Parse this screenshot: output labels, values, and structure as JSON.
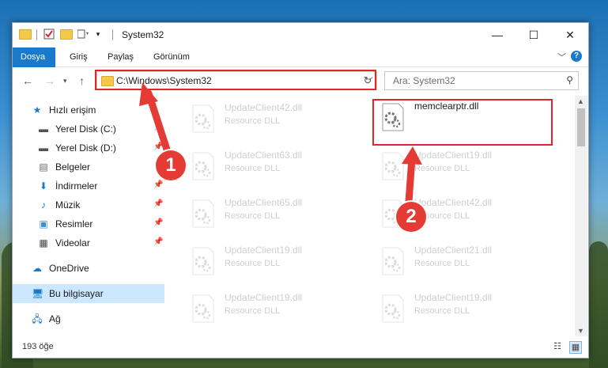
{
  "window": {
    "title": "System32"
  },
  "controls": {
    "minimize": "—",
    "maximize": "☐",
    "close": "✕"
  },
  "ribbon": {
    "tabs": [
      "Dosya",
      "Giriş",
      "Paylaş",
      "Görünüm"
    ],
    "help": "?"
  },
  "nav": {
    "address": "C:\\Windows\\System32",
    "search_placeholder": "Ara: System32"
  },
  "sidebar": {
    "items": [
      {
        "label": "Hızlı erişim",
        "icon": "star-icon"
      },
      {
        "label": "Yerel Disk (C:)",
        "icon": "drive-icon",
        "pinned": true
      },
      {
        "label": "Yerel Disk (D:)",
        "icon": "drive-icon",
        "pinned": true
      },
      {
        "label": "Belgeler",
        "icon": "documents-icon",
        "pinned": true
      },
      {
        "label": "İndirmeler",
        "icon": "download-icon",
        "pinned": true
      },
      {
        "label": "Müzik",
        "icon": "music-icon",
        "pinned": true
      },
      {
        "label": "Resimler",
        "icon": "pictures-icon",
        "pinned": true
      },
      {
        "label": "Videolar",
        "icon": "videos-icon",
        "pinned": true
      },
      {
        "label": "OneDrive",
        "icon": "cloud-icon"
      },
      {
        "label": "Bu bilgisayar",
        "icon": "computer-icon",
        "selected": true
      },
      {
        "label": "Ağ",
        "icon": "network-icon"
      }
    ]
  },
  "files": {
    "left": [
      {
        "name": "UpdateClient42.dll",
        "type": "Resource DLL"
      },
      {
        "name": "UpdateClient63.dll",
        "type": "Resource DLL"
      },
      {
        "name": "UpdateClient65.dll",
        "type": "Resource DLL"
      },
      {
        "name": "UpdateClient19.dll",
        "type": "Resource DLL"
      },
      {
        "name": "UpdateClient19.dll",
        "type": "Resource DLL"
      }
    ],
    "right": [
      {
        "name": "memclearptr.dll",
        "type": ""
      },
      {
        "name": "UpdateClient19.dll",
        "type": "Resource DLL"
      },
      {
        "name": "UpdateClient42.dll",
        "type": "Resource DLL"
      },
      {
        "name": "UpdateClient21.dll",
        "type": "Resource DLL"
      },
      {
        "name": "UpdateClient19.dll",
        "type": "Resource DLL"
      }
    ]
  },
  "status": {
    "count": "193 öğe"
  },
  "annotations": {
    "marker1": "1",
    "marker2": "2",
    "highlight_color": "#e0262b"
  }
}
